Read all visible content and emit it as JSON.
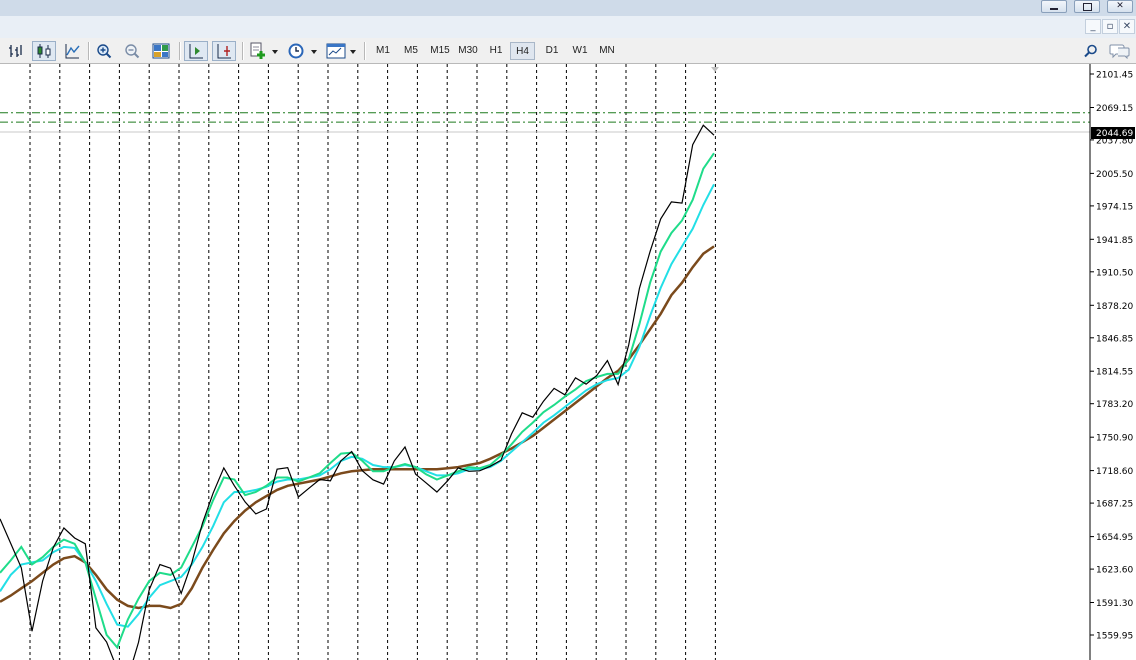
{
  "toolbar": {
    "timeframes": [
      "M1",
      "M5",
      "M15",
      "M30",
      "H1",
      "H4",
      "D1",
      "W1",
      "MN"
    ],
    "active_timeframe": "H4",
    "icons": [
      "bar-chart-icon",
      "candlestick-icon",
      "line-chart-icon",
      "zoom-in-icon",
      "zoom-out-icon",
      "tile-windows-icon",
      "chart-shift-icon",
      "autoscroll-icon",
      "indicators-icon",
      "periods-clock-icon",
      "templates-icon"
    ],
    "right_icons": [
      "search-icon",
      "chat-icon"
    ]
  },
  "colors": {
    "price": "#000000",
    "ma_fast": "#1fdc8a",
    "ma_mid": "#22dfe6",
    "ma_slow": "#7b4a1c",
    "level_lines": "#1d7a1d",
    "current_price_bg": "#000000",
    "grid": "#000000"
  },
  "chart_data": {
    "type": "line",
    "title": "",
    "xlabel": "",
    "ylabel": "",
    "ylim": [
      1545.0,
      2110.0
    ],
    "y_ticks": [
      "2101.45",
      "2069.15",
      "2037.80",
      "2005.50",
      "1974.15",
      "1941.85",
      "1910.50",
      "1878.20",
      "1846.85",
      "1814.55",
      "1783.20",
      "1750.90",
      "1718.60",
      "1687.25",
      "1654.95",
      "1623.60",
      "1591.30",
      "1559.95"
    ],
    "current_price": "2044.69",
    "horizontal_levels": [
      2064.0,
      2055.0
    ],
    "grid": "vertical dotted",
    "x_points": 48,
    "series": [
      {
        "values": [
          1680,
          1650,
          1620,
          1570,
          1612,
          1638,
          1668,
          1652,
          1640,
          1570,
          1550,
          1535,
          1520,
          1548,
          1610,
          1628,
          1618,
          1605,
          1628,
          1660,
          1700,
          1718,
          1712,
          1690,
          1672,
          1688,
          1720,
          1715,
          1698,
          1700,
          1702,
          1712,
          1725,
          1745,
          1720,
          1705,
          1712,
          1728,
          1735,
          1720,
          1705,
          1690,
          1712,
          1718,
          1726,
          1720,
          1718,
          1735,
          1754,
          1768,
          1775,
          1784,
          1790,
          1795,
          1805,
          1810,
          1812,
          1820,
          1808,
          1840,
          1888,
          1935,
          1960,
          1970,
          1980,
          2030,
          2060,
          2044
        ]
      },
      {
        "values": [
          1620,
          1632,
          1645,
          1628,
          1635,
          1645,
          1652,
          1648,
          1630,
          1595,
          1560,
          1548,
          1575,
          1595,
          1612,
          1620,
          1618,
          1625,
          1645,
          1665,
          1690,
          1712,
          1710,
          1695,
          1698,
          1704,
          1712,
          1712,
          1708,
          1712,
          1716,
          1726,
          1735,
          1736,
          1728,
          1718,
          1718,
          1722,
          1725,
          1722,
          1715,
          1710,
          1714,
          1718,
          1722,
          1721,
          1724,
          1733,
          1744,
          1756,
          1765,
          1775,
          1782,
          1790,
          1797,
          1805,
          1809,
          1812,
          1812,
          1826,
          1860,
          1900,
          1930,
          1948,
          1960,
          1980,
          2010,
          2025
        ]
      },
      {
        "values": [
          1602,
          1618,
          1628,
          1630,
          1632,
          1640,
          1645,
          1644,
          1630,
          1612,
          1590,
          1570,
          1568,
          1580,
          1596,
          1608,
          1612,
          1616,
          1628,
          1645,
          1665,
          1688,
          1698,
          1698,
          1700,
          1703,
          1708,
          1710,
          1710,
          1712,
          1714,
          1720,
          1728,
          1732,
          1730,
          1724,
          1722,
          1722,
          1724,
          1722,
          1718,
          1714,
          1714,
          1716,
          1720,
          1720,
          1722,
          1728,
          1737,
          1746,
          1755,
          1765,
          1772,
          1780,
          1788,
          1796,
          1802,
          1806,
          1808,
          1816,
          1838,
          1868,
          1895,
          1918,
          1935,
          1952,
          1975,
          1995
        ]
      },
      {
        "values": [
          1592,
          1598,
          1605,
          1612,
          1620,
          1628,
          1634,
          1636,
          1630,
          1618,
          1604,
          1594,
          1588,
          1586,
          1588,
          1588,
          1586,
          1590,
          1605,
          1625,
          1642,
          1658,
          1670,
          1680,
          1688,
          1694,
          1700,
          1704,
          1706,
          1708,
          1710,
          1713,
          1716,
          1718,
          1719,
          1720,
          1720,
          1720,
          1720,
          1720,
          1720,
          1720,
          1721,
          1722,
          1724,
          1726,
          1730,
          1735,
          1740,
          1746,
          1752,
          1760,
          1768,
          1776,
          1784,
          1792,
          1800,
          1808,
          1815,
          1826,
          1840,
          1855,
          1870,
          1888,
          1900,
          1915,
          1928,
          1935
        ]
      }
    ]
  }
}
